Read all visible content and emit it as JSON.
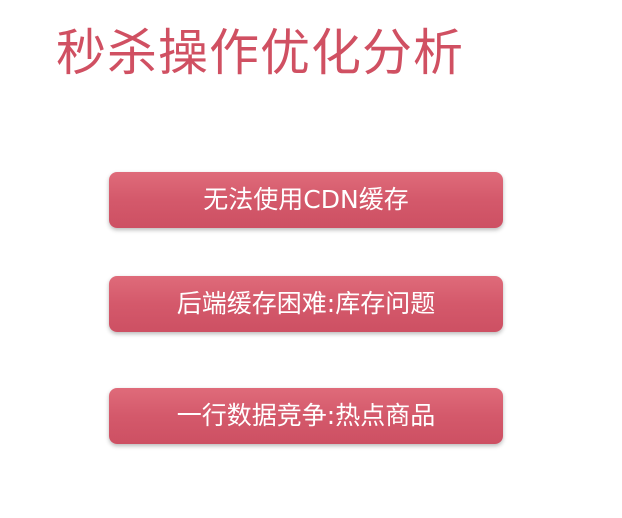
{
  "slide": {
    "title": "秒杀操作优化分析",
    "points": [
      "无法使用CDN缓存",
      "后端缓存困难:库存问题",
      "一行数据竞争:热点商品"
    ]
  },
  "colors": {
    "title": "#d05062",
    "box_fill": "#d4596b",
    "box_text": "#ffffff",
    "background": "#ffffff"
  }
}
